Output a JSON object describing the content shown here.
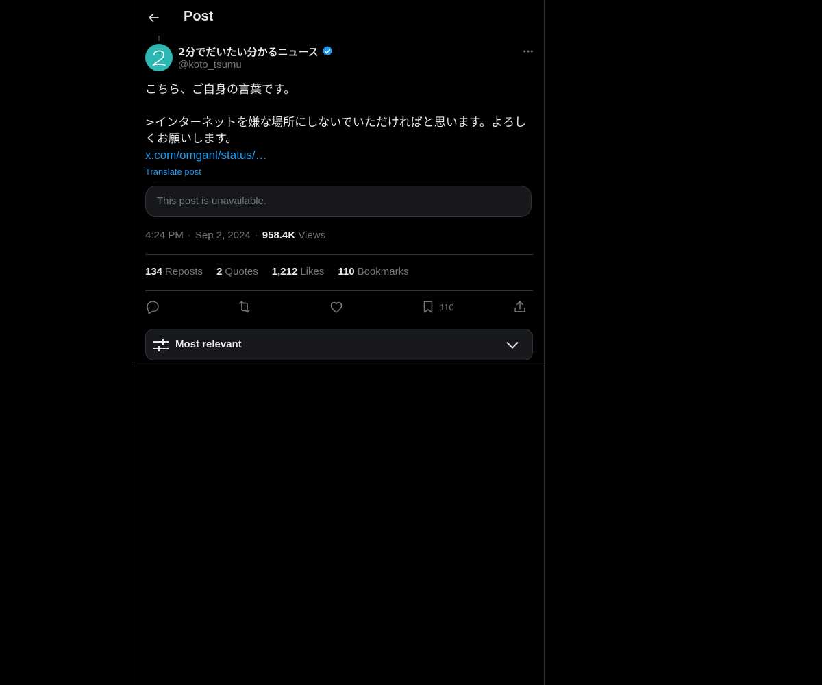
{
  "header": {
    "title": "Post",
    "back_icon": "arrow-left-icon"
  },
  "author": {
    "display_name": "2分でだいたい分かるニュース",
    "handle": "@koto_tsumu",
    "verified": true,
    "avatar_color": "#2fb7b4"
  },
  "post": {
    "text": "こちら、ご自身の言葉です。\n\n>インターネットを嫌な場所にしないでいただければと思います。よろし\nくお願いします。",
    "link": "x.com/omganl/status/…",
    "translate": "Translate post",
    "quote_unavailable": "This post is unavailable."
  },
  "meta": {
    "time": "4:24 PM",
    "date": "Sep 2, 2024",
    "views_count": "958.4K",
    "views_label": "Views",
    "separator": "·"
  },
  "stats": {
    "reposts_count": "134",
    "reposts_label": "Reposts",
    "quotes_count": "2",
    "quotes_label": "Quotes",
    "likes_count": "1,212",
    "likes_label": "Likes",
    "bookmarks_count": "110",
    "bookmarks_label": "Bookmarks"
  },
  "actions": {
    "reply_icon": "reply-icon",
    "repost_icon": "repost-icon",
    "like_icon": "heart-icon",
    "bookmark_icon": "bookmark-icon",
    "bookmark_count": "110",
    "share_icon": "share-icon"
  },
  "sort": {
    "label": "Most relevant",
    "icon": "sliders-icon",
    "chevron": "chevron-down-icon"
  },
  "colors": {
    "accent": "#1d9bf0",
    "background": "#000000",
    "muted": "#71767b",
    "border": "#2f3336"
  }
}
